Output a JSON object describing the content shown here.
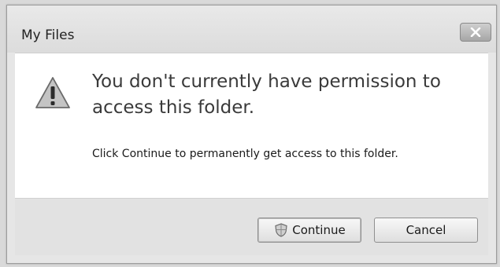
{
  "window": {
    "title": "My Files"
  },
  "dialog": {
    "icon": "warning-icon",
    "main_message": "You don't currently have permission to access this folder.",
    "sub_message": "Click Continue to permanently get access to this folder."
  },
  "buttons": {
    "continue_label": "Continue",
    "continue_icon": "shield-icon",
    "cancel_label": "Cancel",
    "close_icon": "close-icon"
  },
  "colors": {
    "warning_fill": "#bdbdbd",
    "content_background": "#ffffff",
    "footer_background": "#e2e2e2"
  }
}
